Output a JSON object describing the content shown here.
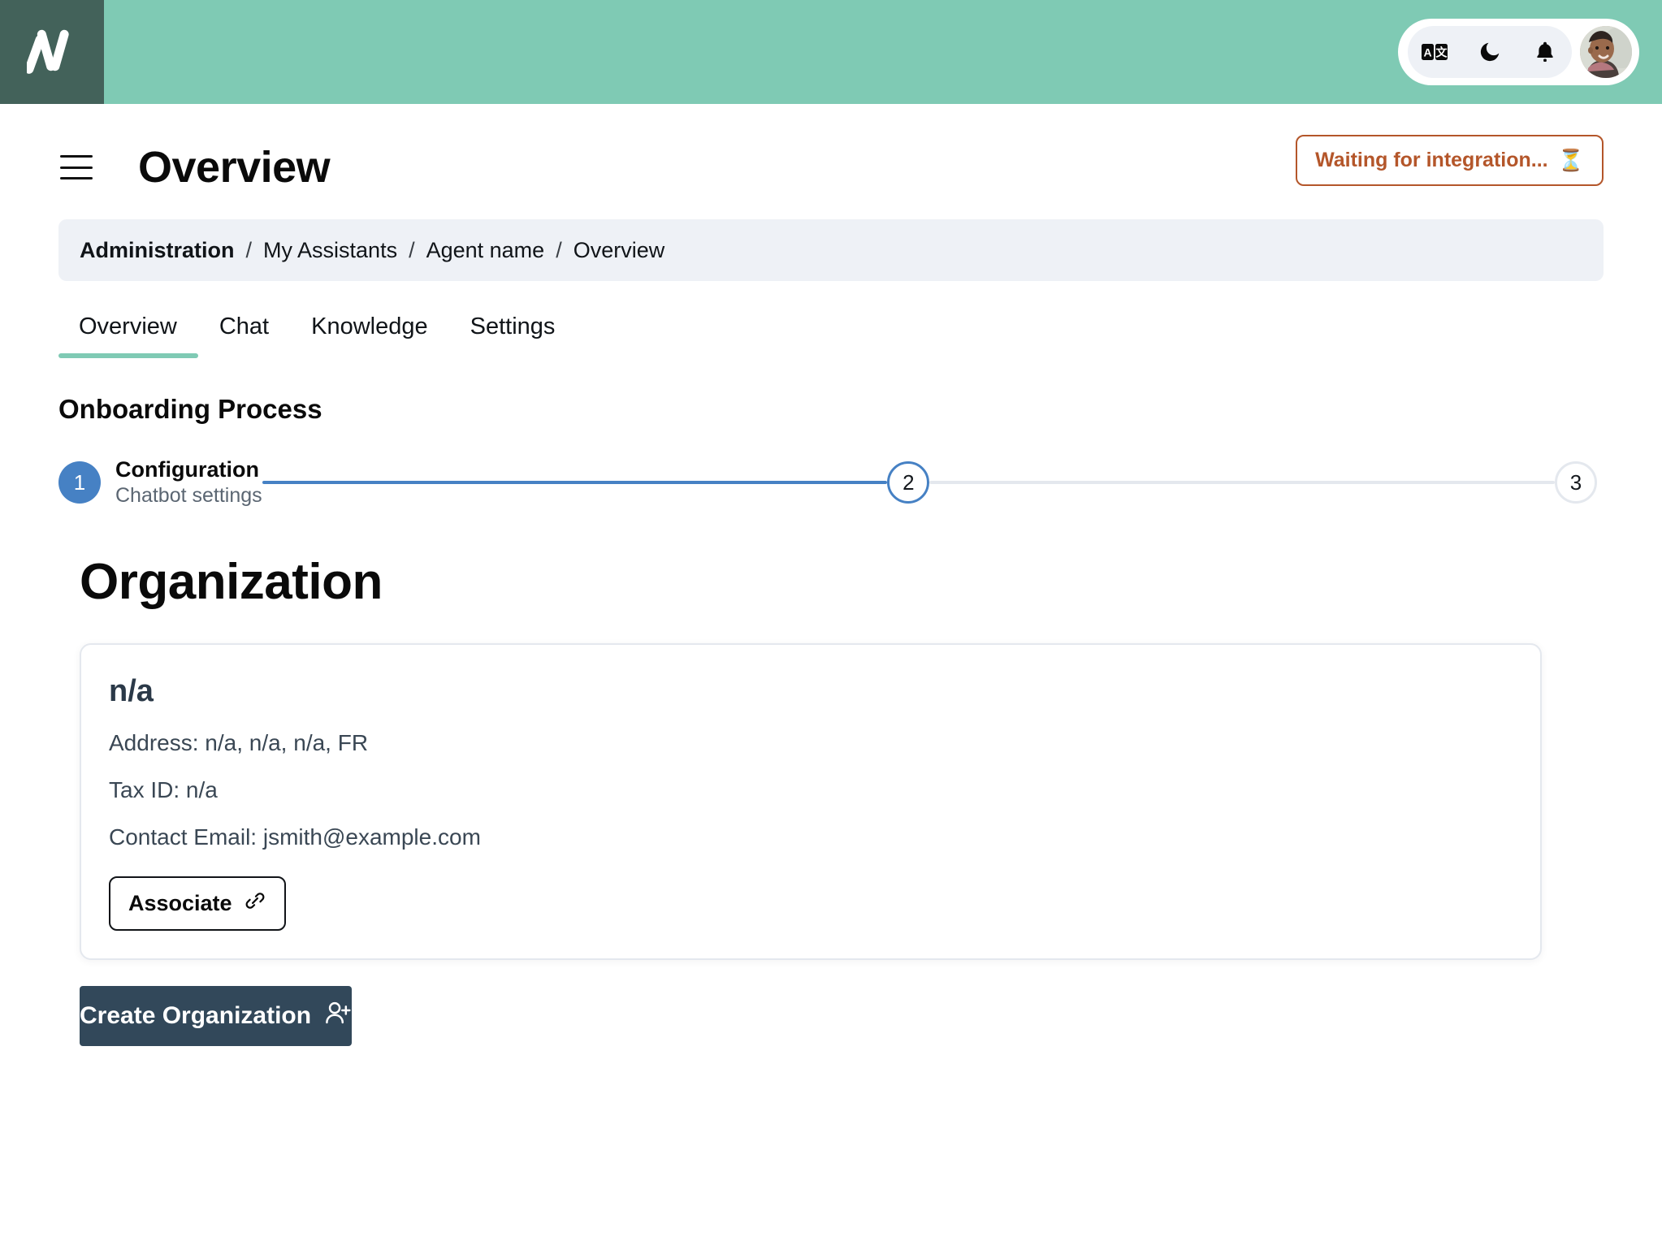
{
  "topbar": {
    "logo_name": "app-logo",
    "icons": [
      {
        "name": "translate-icon",
        "label": "Language"
      },
      {
        "name": "moon-icon",
        "label": "Dark mode"
      },
      {
        "name": "bell-icon",
        "label": "Notifications"
      }
    ],
    "avatar_label": "User avatar"
  },
  "header": {
    "menu_label": "Menu",
    "title": "Overview",
    "status": {
      "text": "Waiting for integration...",
      "icon": "⏳",
      "color": "#b4562a"
    }
  },
  "breadcrumb": {
    "separator": "/",
    "items": [
      {
        "label": "Administration",
        "current": true
      },
      {
        "label": "My Assistants",
        "current": false
      },
      {
        "label": "Agent name",
        "current": false
      },
      {
        "label": "Overview",
        "current": false
      }
    ]
  },
  "tabs": [
    {
      "label": "Overview",
      "active": true
    },
    {
      "label": "Chat",
      "active": false
    },
    {
      "label": "Knowledge",
      "active": false
    },
    {
      "label": "Settings",
      "active": false
    }
  ],
  "onboarding": {
    "title": "Onboarding Process",
    "steps": [
      {
        "number": "1",
        "label": "Configuration",
        "sublabel": "Chatbot settings",
        "state": "done"
      },
      {
        "number": "2",
        "label": "",
        "sublabel": "",
        "state": "current"
      },
      {
        "number": "3",
        "label": "",
        "sublabel": "",
        "state": "todo"
      }
    ],
    "connector_colors": {
      "completed": "#4681c4",
      "pending": "#e4e8ee"
    }
  },
  "organization": {
    "heading": "Organization",
    "card": {
      "name": "n/a",
      "address": "Address: n/a, n/a, n/a, FR",
      "tax_id": "Tax ID: n/a",
      "contact_email": "Contact Email: jsmith@example.com",
      "associate_button": "Associate"
    },
    "create_button": "Create Organization"
  },
  "colors": {
    "header_green": "#7fcab4",
    "logo_tile": "#43625a",
    "accent_green": "#7fcab4",
    "step_blue": "#4681c4",
    "dark_button": "#32485a",
    "breadcrumb_bg": "#eef1f6"
  }
}
